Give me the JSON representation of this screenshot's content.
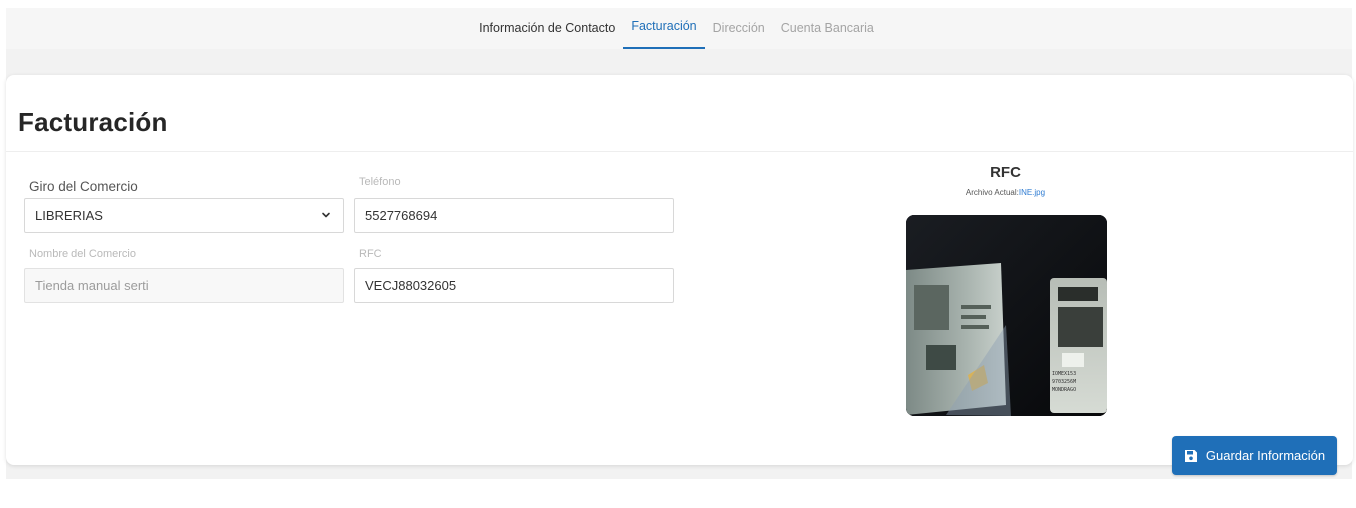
{
  "tabs": [
    {
      "label": "Información de Contacto",
      "state": "done"
    },
    {
      "label": "Facturación",
      "state": "active"
    },
    {
      "label": "Dirección",
      "state": "pending"
    },
    {
      "label": "Cuenta Bancaria",
      "state": "pending"
    }
  ],
  "page_title": "Facturación",
  "form": {
    "giro": {
      "label": "Giro del Comercio",
      "value": "LIBRERIAS"
    },
    "telefono": {
      "label": "Teléfono",
      "value": "5527768694"
    },
    "nombre": {
      "label": "Nombre del Comercio",
      "value": "Tienda manual serti"
    },
    "rfc": {
      "label": "RFC",
      "value": "VECJ88032605"
    }
  },
  "rfc_upload": {
    "title": "RFC",
    "file_prefix": "Archivo Actual:",
    "file_name": "INE.jpg"
  },
  "save_button": {
    "label": "Guardar Información",
    "icon": "save-icon"
  },
  "colors": {
    "accent": "#1f6fb8",
    "link": "#2d7bd2",
    "muted": "#a4a4a4"
  }
}
